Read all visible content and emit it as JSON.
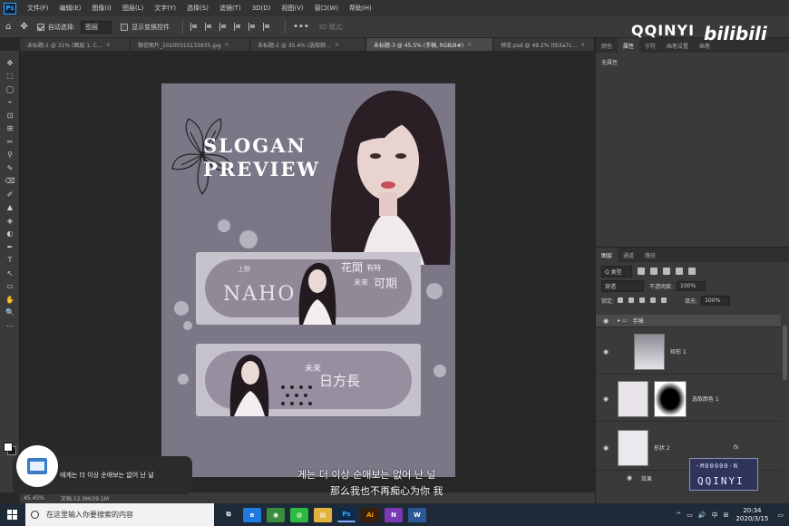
{
  "app": {
    "logo_text": "Ps",
    "menu": [
      "文件(F)",
      "编辑(E)",
      "图像(I)",
      "图层(L)",
      "文字(Y)",
      "选择(S)",
      "滤镜(T)",
      "3D(D)",
      "视图(V)",
      "窗口(W)",
      "帮助(H)"
    ]
  },
  "options": {
    "auto_select_label": "自动选择:",
    "auto_select_value": "图层",
    "show_transform_label": "显示变换控件",
    "mode_3d_label": "3D 模式:"
  },
  "tabs": [
    {
      "label": "未标题-1 @ 31% (图层 1, C..."
    },
    {
      "label": "微信图片_20200315133935.jpg"
    },
    {
      "label": "未标题-2 @ 35.4% (选取颜..."
    },
    {
      "label": "未标题-3 @ 45.5% (手稿, RGB/8#)"
    },
    {
      "label": "预览.psd @ 49.2% (tb3a7c..."
    }
  ],
  "tab_close": "×",
  "tools": [
    "✥",
    "⬚",
    "◯",
    "⌁",
    "⊡",
    "⊞",
    "✂",
    "⚲",
    "✎",
    "⌫",
    "✐",
    "▲",
    "◈",
    "◐",
    "✒",
    "T",
    "↖",
    "▭",
    "✋",
    "🔍",
    "⋯"
  ],
  "canvas": {
    "slogan_line1": "SLOGAN",
    "slogan_line2": "PREVIEW",
    "banner1_small": "上野",
    "banner1_name": "NAHO",
    "banner1_cn_a": "花間",
    "banner1_cn_b": "有時",
    "banner1_cn_c": "未來",
    "banner1_cn_d": "可期",
    "banner2_cn_a": "未來",
    "banner2_cn_b": "日方長"
  },
  "panel_top": {
    "tabs": [
      "颜色",
      "属性",
      "字符",
      "画笔设置",
      "画笔"
    ],
    "sub_label": "无属性"
  },
  "layers_panel": {
    "tabs": [
      "图层",
      "通道",
      "路径"
    ],
    "kind_label": "Q 类型",
    "blend_mode": "穿透",
    "opacity_label": "不透明度:",
    "opacity_value": "100%",
    "lock_label": "锁定:",
    "fill_label": "填充:",
    "fill_value": "100%",
    "layers": [
      {
        "name": "手稿",
        "type": "group"
      },
      {
        "name": "矩形 1",
        "type": "shape"
      },
      {
        "name": "选取颜色 1",
        "type": "adjustment"
      },
      {
        "name": "形状 2",
        "type": "shape"
      },
      {
        "name": "效果",
        "type": "effect"
      }
    ],
    "fx_label": "fx"
  },
  "status": {
    "zoom": "45.45%",
    "doc": "文档:12.0M/29.1M"
  },
  "taskbar": {
    "search_placeholder": "在这里输入你要搜索的内容",
    "apps": [
      {
        "name": "task-view",
        "label": "⧉",
        "color": "#1e2a38"
      },
      {
        "name": "edge",
        "label": "e",
        "color": "#1f7ae0"
      },
      {
        "name": "chrome",
        "label": "◉",
        "color": "#3a8d3f"
      },
      {
        "name": "wechat",
        "label": "◍",
        "color": "#2dbb3f"
      },
      {
        "name": "explorer",
        "label": "▤",
        "color": "#e3b23c"
      },
      {
        "name": "photoshop",
        "label": "Ps",
        "color": "#0c2b4f",
        "active": true
      },
      {
        "name": "illustrator",
        "label": "Ai",
        "color": "#3a1f0a"
      },
      {
        "name": "onenote",
        "label": "N",
        "color": "#7a3ab3"
      },
      {
        "name": "word",
        "label": "W",
        "color": "#2b5797"
      }
    ],
    "tray": [
      "^",
      "▭",
      "🔊",
      "中",
      "⊞"
    ],
    "time": "20:34",
    "date": "2020/3/15"
  },
  "overlays": {
    "watermark": "QQINYI",
    "bilibili": "bilibili",
    "subtitle_kr": "게는 더 이상 순애보는 없어 난 널",
    "subtitle_cn": "那么我也不再痴心为你 我",
    "lyric_kr": "에게는 더 이상 순애보는 없어 난 널",
    "badge_top": "-M00000-N",
    "badge_bottom": "QQINYI"
  },
  "colors": {
    "artboard": "#7c7787",
    "banner": "#c7c3cd",
    "accent": "#31a8ff"
  }
}
